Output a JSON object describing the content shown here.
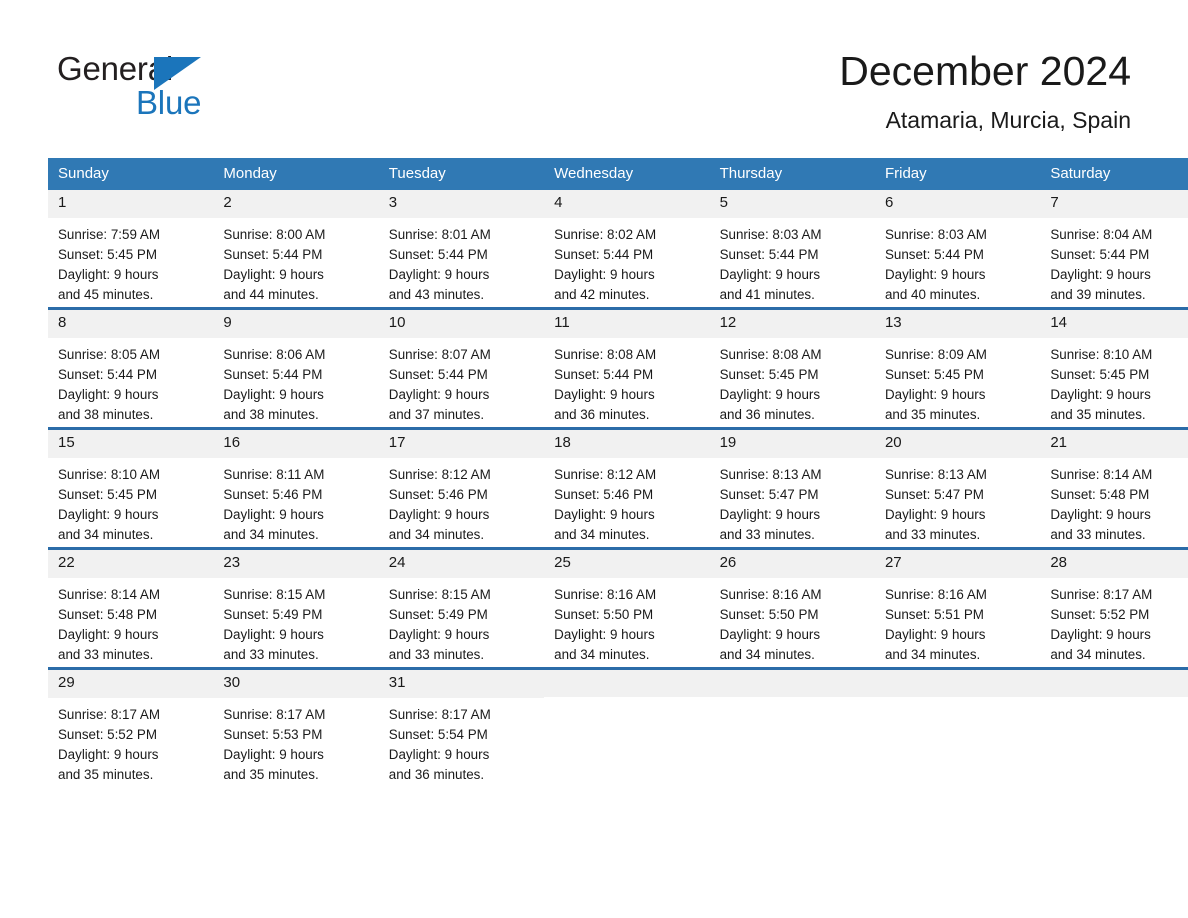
{
  "brand": {
    "line1": "General",
    "line2": "Blue",
    "flag_color": "#1b75bb"
  },
  "header": {
    "title": "December 2024",
    "subtitle": "Atamaria, Murcia, Spain"
  },
  "theme": {
    "header_blue": "#3079b4",
    "rule_blue": "#2b6ca8",
    "daynum_bg": "#f1f1f1",
    "text": "#1a1a1a"
  },
  "weekday_headers": [
    "Sunday",
    "Monday",
    "Tuesday",
    "Wednesday",
    "Thursday",
    "Friday",
    "Saturday"
  ],
  "weeks": [
    [
      {
        "day": "1",
        "sunrise": "Sunrise: 7:59 AM",
        "sunset": "Sunset: 5:45 PM",
        "daylight1": "Daylight: 9 hours",
        "daylight2": "and 45 minutes."
      },
      {
        "day": "2",
        "sunrise": "Sunrise: 8:00 AM",
        "sunset": "Sunset: 5:44 PM",
        "daylight1": "Daylight: 9 hours",
        "daylight2": "and 44 minutes."
      },
      {
        "day": "3",
        "sunrise": "Sunrise: 8:01 AM",
        "sunset": "Sunset: 5:44 PM",
        "daylight1": "Daylight: 9 hours",
        "daylight2": "and 43 minutes."
      },
      {
        "day": "4",
        "sunrise": "Sunrise: 8:02 AM",
        "sunset": "Sunset: 5:44 PM",
        "daylight1": "Daylight: 9 hours",
        "daylight2": "and 42 minutes."
      },
      {
        "day": "5",
        "sunrise": "Sunrise: 8:03 AM",
        "sunset": "Sunset: 5:44 PM",
        "daylight1": "Daylight: 9 hours",
        "daylight2": "and 41 minutes."
      },
      {
        "day": "6",
        "sunrise": "Sunrise: 8:03 AM",
        "sunset": "Sunset: 5:44 PM",
        "daylight1": "Daylight: 9 hours",
        "daylight2": "and 40 minutes."
      },
      {
        "day": "7",
        "sunrise": "Sunrise: 8:04 AM",
        "sunset": "Sunset: 5:44 PM",
        "daylight1": "Daylight: 9 hours",
        "daylight2": "and 39 minutes."
      }
    ],
    [
      {
        "day": "8",
        "sunrise": "Sunrise: 8:05 AM",
        "sunset": "Sunset: 5:44 PM",
        "daylight1": "Daylight: 9 hours",
        "daylight2": "and 38 minutes."
      },
      {
        "day": "9",
        "sunrise": "Sunrise: 8:06 AM",
        "sunset": "Sunset: 5:44 PM",
        "daylight1": "Daylight: 9 hours",
        "daylight2": "and 38 minutes."
      },
      {
        "day": "10",
        "sunrise": "Sunrise: 8:07 AM",
        "sunset": "Sunset: 5:44 PM",
        "daylight1": "Daylight: 9 hours",
        "daylight2": "and 37 minutes."
      },
      {
        "day": "11",
        "sunrise": "Sunrise: 8:08 AM",
        "sunset": "Sunset: 5:44 PM",
        "daylight1": "Daylight: 9 hours",
        "daylight2": "and 36 minutes."
      },
      {
        "day": "12",
        "sunrise": "Sunrise: 8:08 AM",
        "sunset": "Sunset: 5:45 PM",
        "daylight1": "Daylight: 9 hours",
        "daylight2": "and 36 minutes."
      },
      {
        "day": "13",
        "sunrise": "Sunrise: 8:09 AM",
        "sunset": "Sunset: 5:45 PM",
        "daylight1": "Daylight: 9 hours",
        "daylight2": "and 35 minutes."
      },
      {
        "day": "14",
        "sunrise": "Sunrise: 8:10 AM",
        "sunset": "Sunset: 5:45 PM",
        "daylight1": "Daylight: 9 hours",
        "daylight2": "and 35 minutes."
      }
    ],
    [
      {
        "day": "15",
        "sunrise": "Sunrise: 8:10 AM",
        "sunset": "Sunset: 5:45 PM",
        "daylight1": "Daylight: 9 hours",
        "daylight2": "and 34 minutes."
      },
      {
        "day": "16",
        "sunrise": "Sunrise: 8:11 AM",
        "sunset": "Sunset: 5:46 PM",
        "daylight1": "Daylight: 9 hours",
        "daylight2": "and 34 minutes."
      },
      {
        "day": "17",
        "sunrise": "Sunrise: 8:12 AM",
        "sunset": "Sunset: 5:46 PM",
        "daylight1": "Daylight: 9 hours",
        "daylight2": "and 34 minutes."
      },
      {
        "day": "18",
        "sunrise": "Sunrise: 8:12 AM",
        "sunset": "Sunset: 5:46 PM",
        "daylight1": "Daylight: 9 hours",
        "daylight2": "and 34 minutes."
      },
      {
        "day": "19",
        "sunrise": "Sunrise: 8:13 AM",
        "sunset": "Sunset: 5:47 PM",
        "daylight1": "Daylight: 9 hours",
        "daylight2": "and 33 minutes."
      },
      {
        "day": "20",
        "sunrise": "Sunrise: 8:13 AM",
        "sunset": "Sunset: 5:47 PM",
        "daylight1": "Daylight: 9 hours",
        "daylight2": "and 33 minutes."
      },
      {
        "day": "21",
        "sunrise": "Sunrise: 8:14 AM",
        "sunset": "Sunset: 5:48 PM",
        "daylight1": "Daylight: 9 hours",
        "daylight2": "and 33 minutes."
      }
    ],
    [
      {
        "day": "22",
        "sunrise": "Sunrise: 8:14 AM",
        "sunset": "Sunset: 5:48 PM",
        "daylight1": "Daylight: 9 hours",
        "daylight2": "and 33 minutes."
      },
      {
        "day": "23",
        "sunrise": "Sunrise: 8:15 AM",
        "sunset": "Sunset: 5:49 PM",
        "daylight1": "Daylight: 9 hours",
        "daylight2": "and 33 minutes."
      },
      {
        "day": "24",
        "sunrise": "Sunrise: 8:15 AM",
        "sunset": "Sunset: 5:49 PM",
        "daylight1": "Daylight: 9 hours",
        "daylight2": "and 33 minutes."
      },
      {
        "day": "25",
        "sunrise": "Sunrise: 8:16 AM",
        "sunset": "Sunset: 5:50 PM",
        "daylight1": "Daylight: 9 hours",
        "daylight2": "and 34 minutes."
      },
      {
        "day": "26",
        "sunrise": "Sunrise: 8:16 AM",
        "sunset": "Sunset: 5:50 PM",
        "daylight1": "Daylight: 9 hours",
        "daylight2": "and 34 minutes."
      },
      {
        "day": "27",
        "sunrise": "Sunrise: 8:16 AM",
        "sunset": "Sunset: 5:51 PM",
        "daylight1": "Daylight: 9 hours",
        "daylight2": "and 34 minutes."
      },
      {
        "day": "28",
        "sunrise": "Sunrise: 8:17 AM",
        "sunset": "Sunset: 5:52 PM",
        "daylight1": "Daylight: 9 hours",
        "daylight2": "and 34 minutes."
      }
    ],
    [
      {
        "day": "29",
        "sunrise": "Sunrise: 8:17 AM",
        "sunset": "Sunset: 5:52 PM",
        "daylight1": "Daylight: 9 hours",
        "daylight2": "and 35 minutes."
      },
      {
        "day": "30",
        "sunrise": "Sunrise: 8:17 AM",
        "sunset": "Sunset: 5:53 PM",
        "daylight1": "Daylight: 9 hours",
        "daylight2": "and 35 minutes."
      },
      {
        "day": "31",
        "sunrise": "Sunrise: 8:17 AM",
        "sunset": "Sunset: 5:54 PM",
        "daylight1": "Daylight: 9 hours",
        "daylight2": "and 36 minutes."
      },
      {
        "day": "",
        "sunrise": "",
        "sunset": "",
        "daylight1": "",
        "daylight2": ""
      },
      {
        "day": "",
        "sunrise": "",
        "sunset": "",
        "daylight1": "",
        "daylight2": ""
      },
      {
        "day": "",
        "sunrise": "",
        "sunset": "",
        "daylight1": "",
        "daylight2": ""
      },
      {
        "day": "",
        "sunrise": "",
        "sunset": "",
        "daylight1": "",
        "daylight2": ""
      }
    ]
  ]
}
